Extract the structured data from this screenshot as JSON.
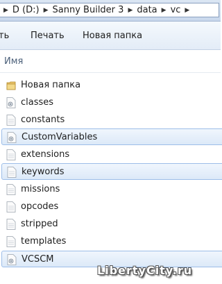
{
  "breadcrumb": {
    "items": [
      "D (D:)",
      "Sanny Builder 3",
      "data",
      "vc"
    ]
  },
  "toolbar": {
    "first_label": "ть",
    "print_label": "Печать",
    "new_folder_label": "Новая папка"
  },
  "list": {
    "column_header": "Имя",
    "items": [
      {
        "label": "Новая папка",
        "icon": "folder-icon",
        "selected": false
      },
      {
        "label": "classes",
        "icon": "config-file-icon",
        "selected": false
      },
      {
        "label": "constants",
        "icon": "text-file-icon",
        "selected": false
      },
      {
        "label": "CustomVariables",
        "icon": "config-file-icon",
        "selected": true
      },
      {
        "label": "extensions",
        "icon": "text-file-icon",
        "selected": false
      },
      {
        "label": "keywords",
        "icon": "text-file-icon",
        "selected": true
      },
      {
        "label": "missions",
        "icon": "text-file-icon",
        "selected": false
      },
      {
        "label": "opcodes",
        "icon": "text-file-icon",
        "selected": false
      },
      {
        "label": "stripped",
        "icon": "text-file-icon",
        "selected": false
      },
      {
        "label": "templates",
        "icon": "text-file-icon",
        "selected": false
      },
      {
        "label": "VCSCM",
        "icon": "config-file-icon",
        "selected": true
      }
    ]
  },
  "watermark": "LibertyCity.ru"
}
